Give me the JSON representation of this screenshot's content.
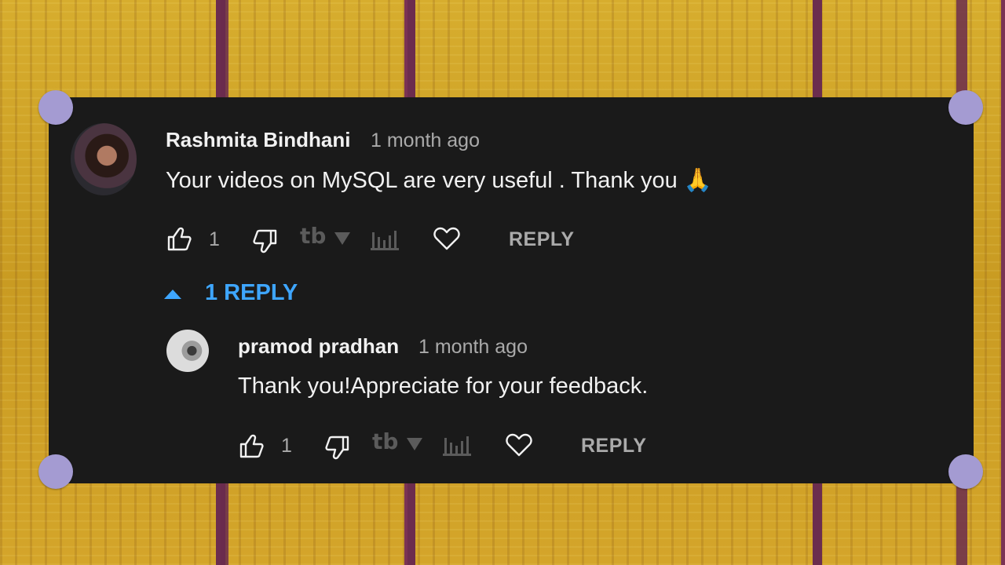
{
  "comment": {
    "author": "Rashmita Bindhani",
    "time": "1 month ago",
    "text": "Your videos on MySQL are very useful . Thank you 🙏",
    "likes": "1",
    "reply_label": "REPLY"
  },
  "replies_toggle": {
    "label": "1 REPLY"
  },
  "reply": {
    "author": "pramod pradhan",
    "time": "1 month ago",
    "text": "Thank you!Appreciate for your feedback.",
    "likes": "1",
    "reply_label": "REPLY"
  },
  "extension": {
    "logo_text": "tb"
  },
  "colors": {
    "card_bg": "#1a1a1a",
    "accent": "#3ea6ff",
    "text": "#f1f1f1",
    "muted": "#aaaaaa",
    "pin": "#a49bd2"
  }
}
